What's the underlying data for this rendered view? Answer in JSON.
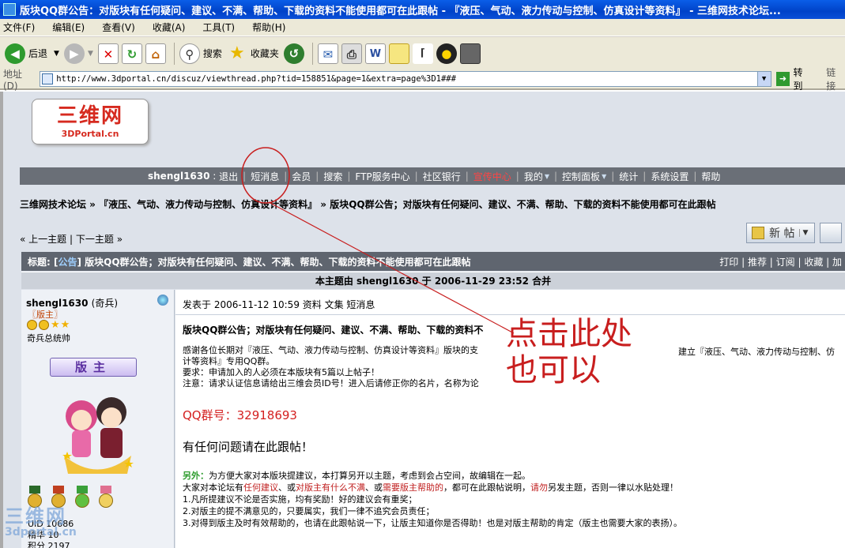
{
  "window": {
    "title": "版块QQ群公告：对版块有任何疑问、建议、不满、帮助、下载的资料不能使用都可在此跟帖 - 『液压、气动、液力传动与控制、仿真设计等资料』 - 三维网技术论坛..."
  },
  "menu": [
    "文件(F)",
    "编辑(E)",
    "查看(V)",
    "收藏(A)",
    "工具(T)",
    "帮助(H)"
  ],
  "toolbar": {
    "back": "后退",
    "search": "搜索",
    "favorites": "收藏夹"
  },
  "address": {
    "label": "地址(D)",
    "url": "http://www.3dportal.cn/discuz/viewthread.php?tid=158851&page=1&extra=page%3D1###",
    "go": "转到",
    "links": "链接"
  },
  "logo": {
    "cn": "三维网",
    "en": "3DPortal.cn"
  },
  "nav": {
    "user": "shengl1630",
    "logout": "退出",
    "items": [
      "短消息",
      "会员",
      "搜索",
      "FTP服务中心",
      "社区银行",
      "宣传中心",
      "我的",
      "控制面板",
      "统计",
      "系统设置",
      "帮助"
    ],
    "highlight_color": "#ff4444"
  },
  "breadcrumb": "三维网技术论坛 » 『液压、气动、液力传动与控制、仿真设计等资料』 » 版块QQ群公告；对版块有任何疑问、建议、不满、帮助、下载的资料不能使用都可在此跟帖",
  "prevnext": {
    "prev": "« 上一主题",
    "sep": "|",
    "next": "下一主题 »"
  },
  "buttons": {
    "new_thread": "新 帖"
  },
  "thread": {
    "title_prefix": "标题: [",
    "title_tag": "公告",
    "title_rest": "] 版块QQ群公告；对版块有任何疑问、建议、不满、帮助、下载的资料不能使用都可在此跟帖",
    "tools": "打印 | 推荐 | 订阅 | 收藏 | 加",
    "merged": "本主题由  shengl1630  于  2006-11-29 23:52  合并"
  },
  "author": {
    "name": "shengl1630",
    "level": "(奇兵)",
    "role": "〖版主〗",
    "rank": "奇兵总统帅",
    "badge": "版主",
    "uid": "UID 10686",
    "elite": "精华 10",
    "points": "积分 2197"
  },
  "post": {
    "meta": "发表于 2006-11-12 10:59  资料  文集  短消息",
    "title": "版块QQ群公告；对版块有任何疑问、建议、不满、帮助、下载的资料不",
    "body1": "感谢各位长期对『液压、气动、液力传动与控制、仿真设计等资料』版块的支",
    "body1_tail": "建立『液压、气动、液力传动与控制、仿",
    "body2": "计等资料』专用QQ群。",
    "body3": "要求：申请加入的人必须在本版块有5篇以上帖子！",
    "body4": "注意：请求认证信息请给出三维会员ID号！进入后请修正你的名片，名称为论",
    "qq": "QQ群号：32918693",
    "ask": "有任何问题请在此跟帖！",
    "extra_label": "另外：",
    "extra1": "为方便大家对本版块提建议，本打算另开以主题，考虑到会占空间，故编辑在一起。",
    "extra2a": "大家对本论坛有",
    "extra2b": "任何建议",
    "extra2c": "、或",
    "extra2d": "对版主有什么不满",
    "extra2e": "、或",
    "extra2f": "需要版主帮助的",
    "extra2g": "，都可在此跟帖说明，",
    "extra2h": "请勿",
    "extra2i": "另发主题，否则一律以水贴处理！",
    "extra3": "1.凡所提建议不论是否实施，均有奖励！好的建议会有重奖；",
    "extra4": "2.对版主的提不满意见的，只要属实，我们一律不追究会员责任；",
    "extra5": "3.对得到版主及时有效帮助的，也请在此跟帖说一下，让版主知道你是否得助！也是对版主帮助的肯定（版主也需要大家的表扬）。"
  },
  "annotation": {
    "line1": "点击此处",
    "line2": "也可以",
    "color": "#c81e1e"
  },
  "watermark": {
    "cn": "三维网",
    "en": "3dportal.cn"
  }
}
